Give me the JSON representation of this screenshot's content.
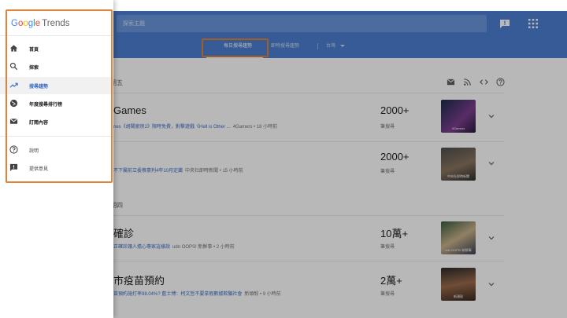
{
  "app": {
    "brand_letters": [
      "G",
      "o",
      "o",
      "g",
      "l",
      "e"
    ],
    "brand_suffix": "Trends",
    "search_placeholder": "探索主題"
  },
  "tabs": [
    {
      "label": "每日搜尋趨勢",
      "active": true
    },
    {
      "label": "即時搜尋趨勢",
      "active": false
    },
    {
      "label": "台灣",
      "active": false
    }
  ],
  "drawer": {
    "items": [
      {
        "label": "首頁",
        "icon": "home-icon",
        "active": false
      },
      {
        "label": "探索",
        "icon": "search-icon",
        "active": false
      },
      {
        "label": "搜尋趨勢",
        "icon": "trending-up-icon",
        "active": true
      },
      {
        "label": "年度搜尋排行榜",
        "icon": "globe-icon",
        "active": false
      },
      {
        "label": "訂閱內容",
        "icon": "mail-icon",
        "active": false
      }
    ],
    "secondary_items": [
      {
        "label": "說明",
        "icon": "help-icon"
      },
      {
        "label": "提供意見",
        "icon": "feedback-icon"
      }
    ]
  },
  "sections": [
    {
      "date": "期五"
    },
    {
      "date": "期四"
    }
  ],
  "cards": [
    {
      "title": "Games",
      "snippet": "nes《胡鬧廚房2》限時免費，對擊遊戲《Hell is Other ...",
      "source": "4Gamers • 18 小時前",
      "count": "2000+",
      "count_label": "筆搜尋",
      "thumb_caption": "4Gamers"
    },
    {
      "title": "",
      "snippet": "不下屬前立委蔡豪判4年10月定讞",
      "source": "中央社即時新聞 • 15 小時前",
      "count": "2000+",
      "count_label": "筆搜尋",
      "thumb_caption": "中央社即時新聞"
    },
    {
      "title": "確診",
      "snippet": "正確診讓人擔心專家這樣說",
      "source": "udn OOPS! 新鮮事 • 2 小時前",
      "count": "10萬+",
      "count_label": "筆搜尋",
      "thumb_caption": "udn OOPS! 新鮮事"
    },
    {
      "title": "市疫苗預約",
      "snippet": "苗預約施打率98.04%? 藍士博：柯文哲不要拿假數據欺騙社會",
      "source": "新頭殼 • 9 小時前",
      "count": "2萬+",
      "count_label": "筆搜尋",
      "thumb_caption": "新頭殼"
    }
  ],
  "colors": {
    "appbar": "#4c7fd0",
    "accent_link": "#3c6ec8",
    "highlight": "#e0833a"
  }
}
